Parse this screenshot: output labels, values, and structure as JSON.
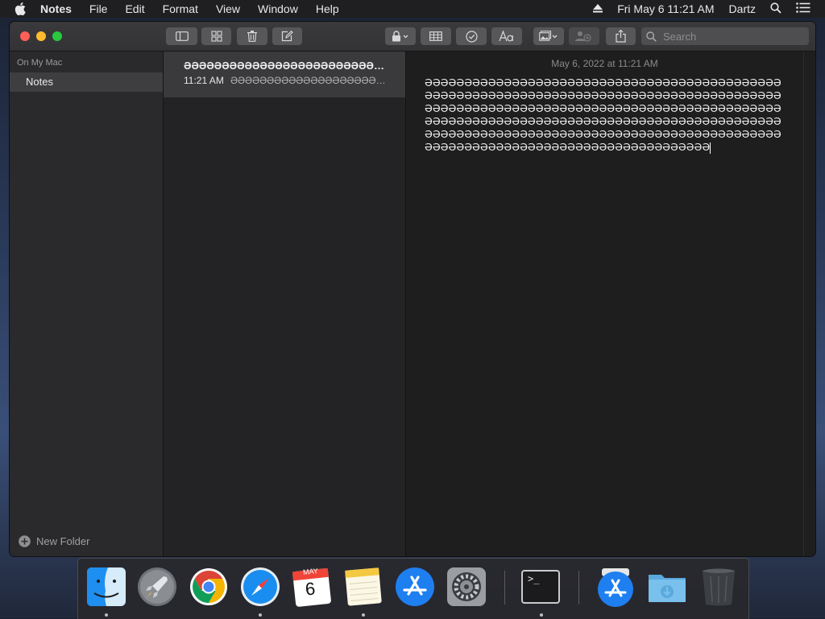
{
  "menubar": {
    "app_name": "Notes",
    "menus": [
      "File",
      "Edit",
      "Format",
      "View",
      "Window",
      "Help"
    ],
    "datetime": "Fri May 6  11:21 AM",
    "user": "Dartz"
  },
  "toolbar": {
    "search_placeholder": "Search"
  },
  "sidebar": {
    "section_title": "On My Mac",
    "folders": [
      {
        "label": "Notes"
      }
    ],
    "new_folder_label": "New Folder"
  },
  "note_list": {
    "items": [
      {
        "title": "ƏƏƏƏƏƏƏƏƏƏƏƏƏƏƏƏƏƏƏƏƏƏƏƏƏƏƏƏƏƏƏƏƏƏƏƏƏƏƏƏƏ",
        "time": "11:21 AM",
        "preview": "ƏƏƏƏƏƏƏƏƏƏƏƏƏƏƏƏƏƏƏƏƏƏƏƏƏƏƏƏƏƏƏƏƏƏƏƏƏƏƏƏƏ"
      }
    ]
  },
  "editor": {
    "date": "May 6, 2022 at 11:21 AM",
    "body": "ƏƏƏƏƏƏƏƏƏƏƏƏƏƏƏƏƏƏƏƏƏƏƏƏƏƏƏƏƏƏƏƏƏƏƏƏƏƏƏƏƏƏƏƏƏƏƏƏƏƏƏƏƏƏƏƏƏƏƏƏƏƏƏƏƏƏƏƏƏƏƏƏƏƏƏƏƏƏƏƏƏƏƏƏƏƏƏƏƏƏƏƏƏƏƏƏƏƏƏƏƏƏƏƏƏƏƏƏƏƏƏƏƏƏƏƏƏƏƏƏƏƏƏƏƏƏƏƏƏƏƏƏƏƏƏƏƏƏƏƏƏƏƏƏƏƏƏƏƏƏƏƏƏƏƏƏƏƏƏƏƏƏƏƏƏƏƏƏƏƏƏƏƏƏƏƏƏƏƏƏƏƏƏƏƏƏƏƏƏƏƏƏƏƏƏƏƏƏƏƏƏƏƏƏƏƏƏƏƏƏƏƏƏƏƏƏƏƏƏƏƏƏƏƏƏƏƏƏƏƏƏƏƏƏƏƏƏƏƏƏƏƏƏƏƏƏƏƏƏƏƏƏƏƏƏƏƏƏƏƏƏ"
  },
  "dock": {
    "calendar_month": "MAY",
    "calendar_day": "6",
    "terminal_prompt": ">_"
  },
  "colors": {
    "close": "#ff5f57",
    "minimize": "#febc2e",
    "zoom": "#28c840",
    "selection": "#3e3e41"
  }
}
